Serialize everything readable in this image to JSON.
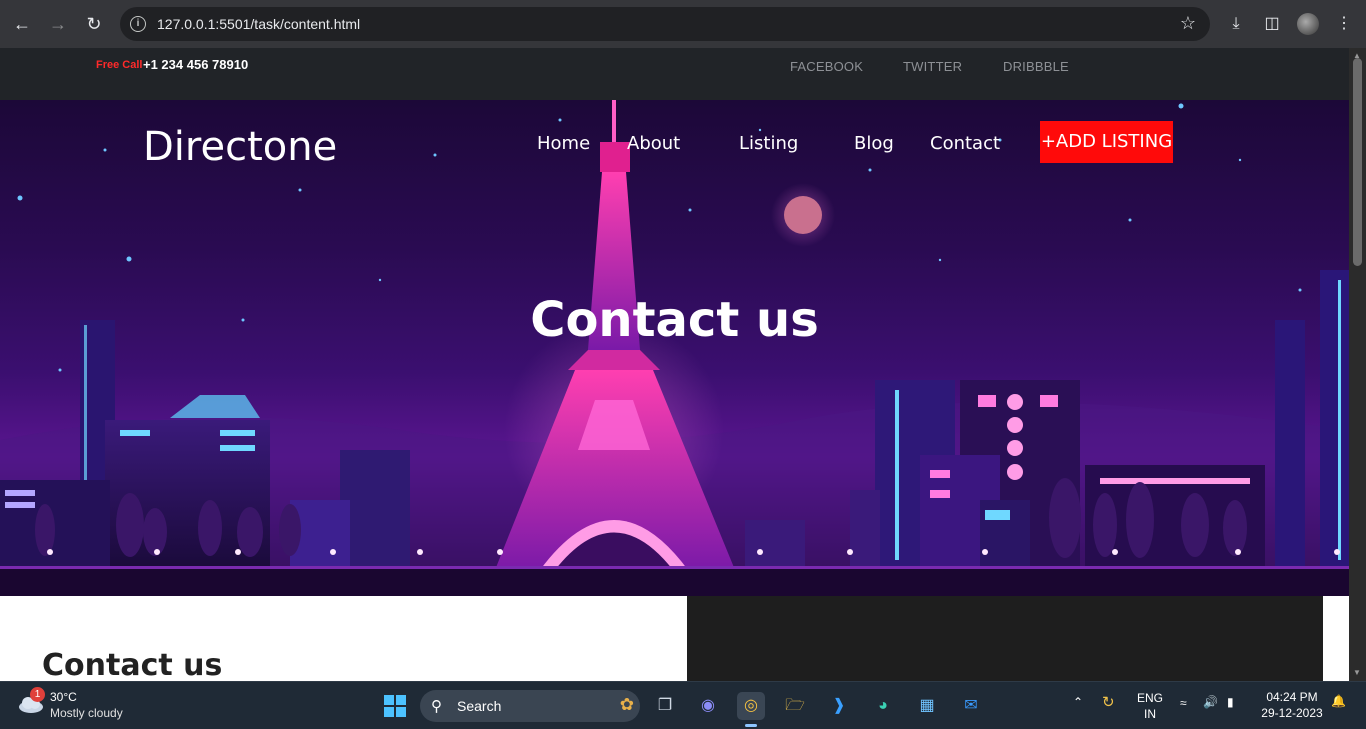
{
  "browser": {
    "url": "127.0.0.1:5501/task/content.html"
  },
  "topbar": {
    "free_call_label": "Free Call",
    "phone": "+1 234 456 78910",
    "social": [
      "FACEBOOK",
      "TWITTER",
      "DRIBBBLE"
    ]
  },
  "header": {
    "brand": "Directone",
    "nav": [
      "Home",
      "About",
      "Listing",
      "Blog",
      "Contact"
    ],
    "add_listing": "+ADD LISTING"
  },
  "hero": {
    "title": "Contact us"
  },
  "section": {
    "heading": "Contact us"
  },
  "taskbar": {
    "notification_count": "1",
    "temperature": "30°C",
    "weather": "Mostly cloudy",
    "search_label": "Search",
    "language_line1": "ENG",
    "language_line2": "IN",
    "time": "04:24 PM",
    "date": "29-12-2023"
  },
  "colors": {
    "accent_red": "#ff0a0a",
    "topbar_bg": "#212428",
    "hero_purple": "#3b0f70"
  }
}
